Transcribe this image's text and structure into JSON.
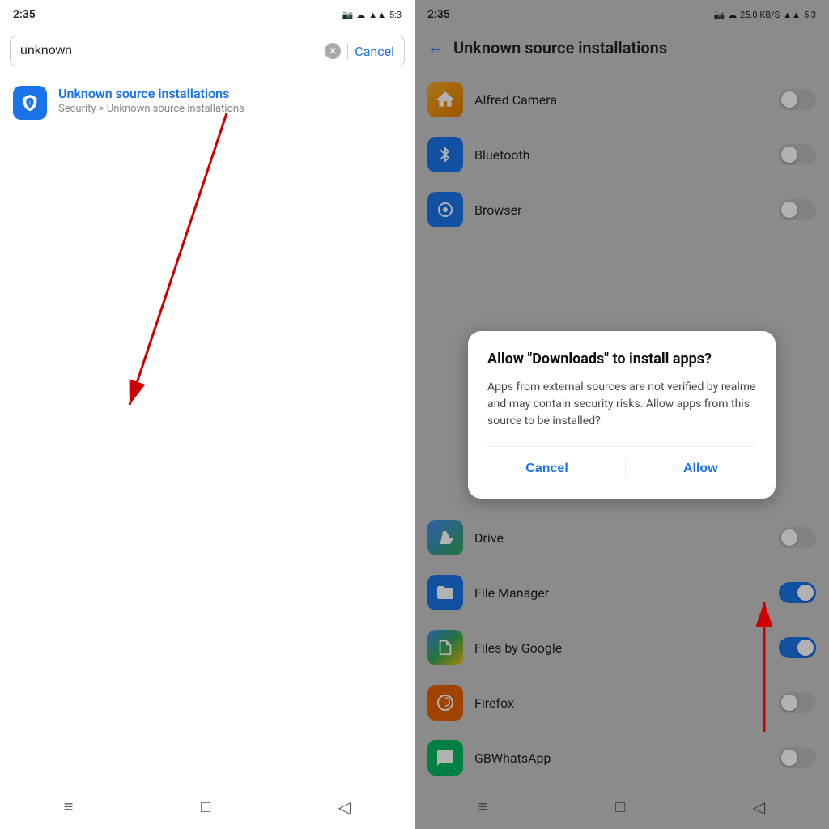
{
  "left": {
    "status_time": "2:35",
    "status_icons": "▪ ▪ ▣ ▪",
    "search_value": "unknown",
    "search_cancel": "Cancel",
    "result": {
      "title_highlight": "Unknown",
      "title_rest": " source installations",
      "subtitle": "Security > Unknown source installations"
    },
    "nav": {
      "menu": "≡",
      "home": "□",
      "back": "◁"
    }
  },
  "right": {
    "status_time": "2:35",
    "page_title": "Unknown source installations",
    "apps": [
      {
        "name": "Alfred Camera",
        "toggle": "off",
        "icon_class": "icon-alfred",
        "icon_char": "🏠"
      },
      {
        "name": "Bluetooth",
        "toggle": "off",
        "icon_class": "icon-bluetooth",
        "icon_char": "✦"
      },
      {
        "name": "Browser",
        "toggle": "off",
        "icon_class": "icon-browser",
        "icon_char": "⬤"
      },
      {
        "name": "Drive",
        "toggle": "off",
        "icon_class": "icon-drive",
        "icon_char": "△"
      },
      {
        "name": "File Manager",
        "toggle": "on",
        "icon_class": "icon-filemanager",
        "icon_char": "📁"
      },
      {
        "name": "Files by Google",
        "toggle": "on",
        "icon_class": "icon-filesgoogle",
        "icon_char": "📄"
      },
      {
        "name": "Firefox",
        "toggle": "off",
        "icon_class": "icon-firefox",
        "icon_char": "🦊"
      },
      {
        "name": "GBWhatsApp",
        "toggle": "off",
        "icon_class": "icon-gbwhatsapp",
        "icon_char": "💬"
      }
    ],
    "dialog": {
      "title": "Allow \"Downloads\" to install apps?",
      "body": "Apps from external sources are not verified by realme and may contain security risks. Allow apps from this source to be installed?",
      "cancel": "Cancel",
      "allow": "Allow"
    },
    "nav": {
      "menu": "≡",
      "home": "□",
      "back": "◁"
    }
  }
}
